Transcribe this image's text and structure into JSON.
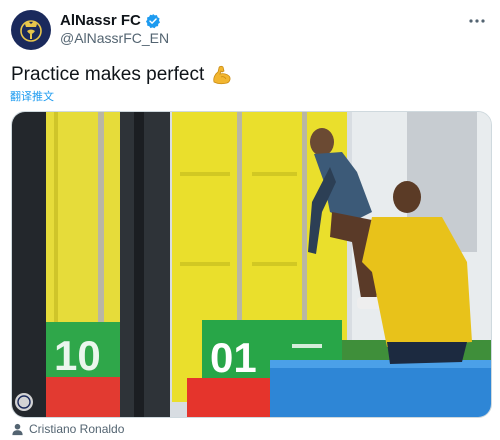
{
  "account": {
    "display_name": "AlNassr FC",
    "handle": "@AlNassrFC_EN",
    "avatar_icon": "club-crest-icon",
    "verified_icon": "verified-badge-icon",
    "verified_color": "#1d9bf0"
  },
  "tweet": {
    "text": "Practice makes perfect",
    "emoji": "flexed-biceps-icon",
    "translate_label": "翻译推文"
  },
  "media": {
    "description_icon": "photo",
    "box_numbers": [
      "10",
      "01"
    ]
  },
  "tagged": {
    "icon": "person-icon",
    "name": "Cristiano Ronaldo"
  },
  "colors": {
    "text": "#0f1419",
    "secondary": "#536471",
    "accent": "#1d9bf0",
    "crest_navy": "#1b2a5c",
    "crest_gold": "#e8c64b"
  }
}
